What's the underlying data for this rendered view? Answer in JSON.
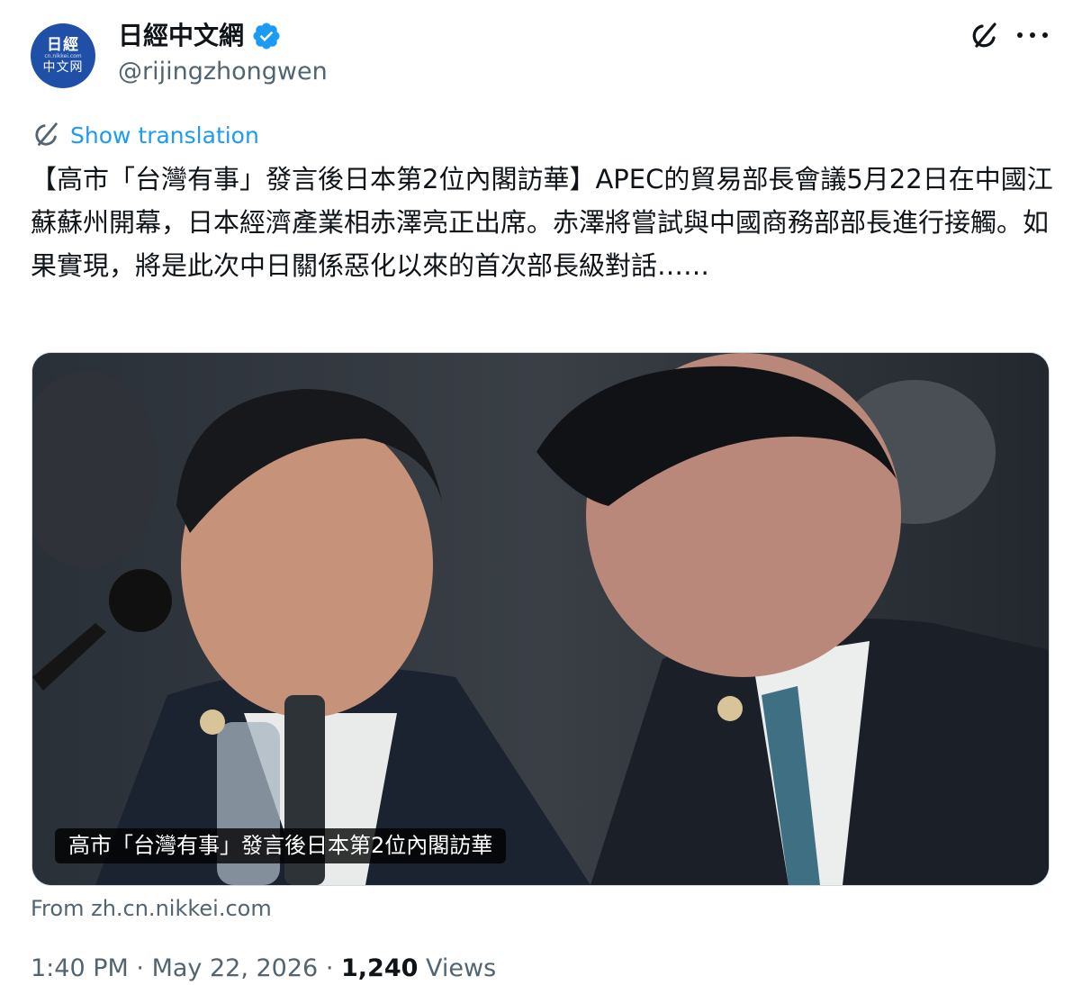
{
  "author": {
    "avatar_lines": [
      "日經",
      "cn.nikkei.com",
      "中文网"
    ],
    "display_name": "日經中文網",
    "handle": "@rijingzhongwen"
  },
  "post": {
    "show_translation": "Show translation",
    "text": "【高市「台灣有事」發言後日本第2位內閣訪華】APEC的貿易部長會議5月22日在中國江蘇蘇州開幕，日本經濟產業相赤澤亮正出席。赤澤將嘗試與中國商務部部長進行接觸。如果實現，將是此次中日關係惡化以來的首次部長級對話……"
  },
  "card": {
    "caption": "高市「台灣有事」發言後日本第2位內閣訪華",
    "source": "From zh.cn.nikkei.com"
  },
  "meta": {
    "time": "1:40 PM",
    "separator": "·",
    "date": "May 22, 2026",
    "views_count": "1,240",
    "views_label": "Views"
  },
  "icons": {
    "verified": "verified-badge-icon",
    "grok": "grok-icon",
    "more": "more-icon",
    "translate": "translate-icon"
  },
  "colors": {
    "accent": "#1d9bf0",
    "secondary_text": "#536471",
    "avatar_bg": "#1f4fa6"
  }
}
